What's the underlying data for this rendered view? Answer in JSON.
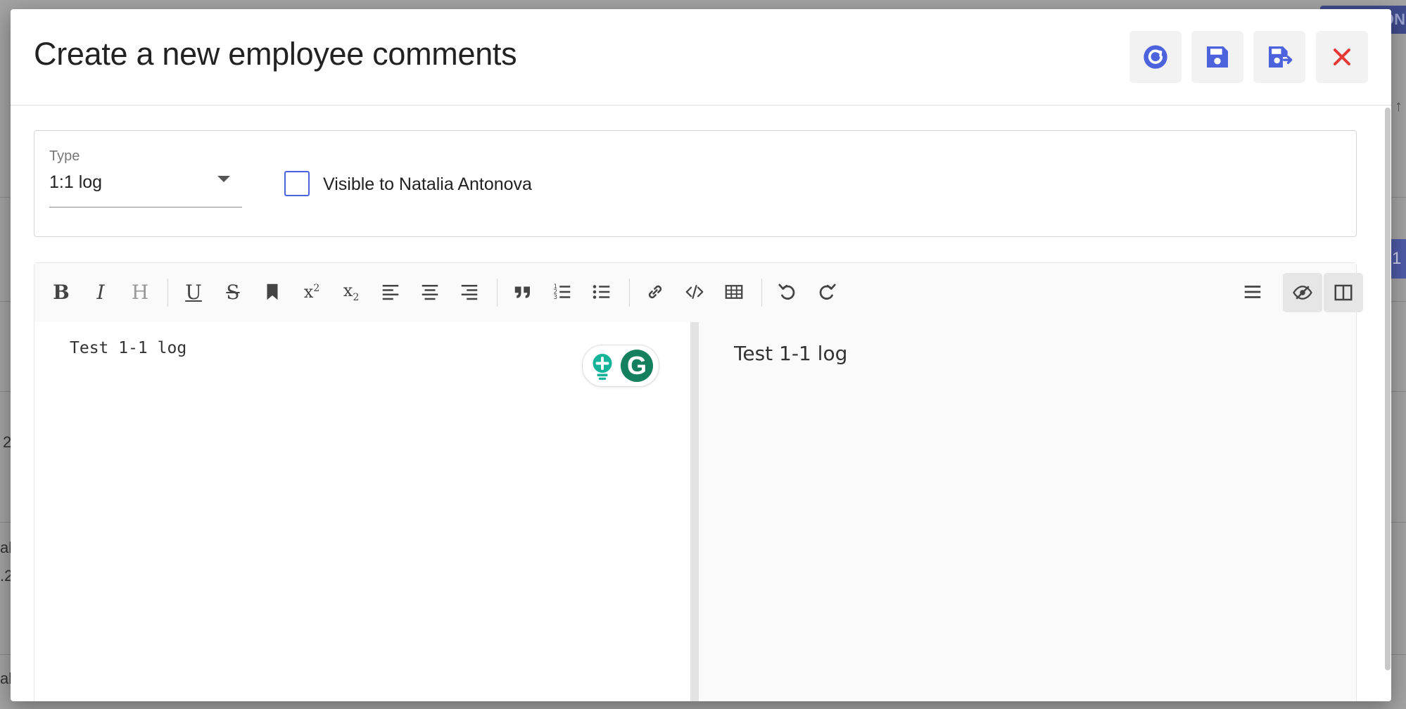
{
  "background": {
    "top_button_text": "ON",
    "badge_text": "1",
    "fragments": [
      "2",
      "al",
      ".2",
      "al"
    ]
  },
  "dialog": {
    "title": "Create a new employee comments",
    "actions": [
      {
        "name": "refresh",
        "icon": "refresh-icon"
      },
      {
        "name": "save",
        "icon": "save-icon"
      },
      {
        "name": "save-and-close",
        "icon": "save-close-icon"
      },
      {
        "name": "close",
        "icon": "close-icon"
      }
    ],
    "accent_color": "#4c63dd",
    "close_color": "#e53935"
  },
  "form": {
    "type_label": "Type",
    "type_value": "1:1 log",
    "visible_checked": false,
    "visible_label": "Visible to Natalia Antonova"
  },
  "editor": {
    "toolbar": [
      "bold",
      "italic",
      "heading",
      "underline",
      "strikethrough",
      "bookmark",
      "superscript",
      "subscript",
      "align-left",
      "align-center",
      "align-right",
      "quote",
      "ordered-list",
      "unordered-list",
      "link",
      "code",
      "table",
      "undo",
      "redo",
      "menu",
      "preview-toggle",
      "split-view"
    ],
    "markdown_text": "Test 1-1 log",
    "preview_text": "Test 1-1 log",
    "grammarly_letter": "G"
  }
}
